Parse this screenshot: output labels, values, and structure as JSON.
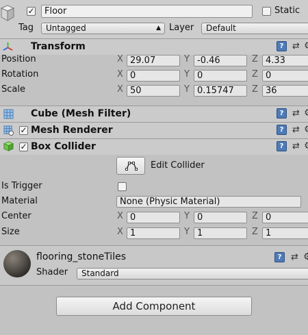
{
  "gameobject": {
    "active": true,
    "name": "Floor",
    "static_checked": false,
    "static_label": "Static",
    "tag_label": "Tag",
    "tag_value": "Untagged",
    "layer_label": "Layer",
    "layer_value": "Default"
  },
  "transform": {
    "title": "Transform",
    "rows": [
      {
        "label": "Position",
        "x": "29.07",
        "y": "-0.46",
        "z": "4.33"
      },
      {
        "label": "Rotation",
        "x": "0",
        "y": "0",
        "z": "0"
      },
      {
        "label": "Scale",
        "x": "50",
        "y": "0.15747",
        "z": "36"
      }
    ]
  },
  "axes": {
    "x": "X",
    "y": "Y",
    "z": "Z"
  },
  "mesh_filter": {
    "title": "Cube (Mesh Filter)"
  },
  "mesh_renderer": {
    "title": "Mesh Renderer",
    "enabled": true
  },
  "box_collider": {
    "title": "Box Collider",
    "enabled": true,
    "edit_label": "Edit Collider",
    "is_trigger_label": "Is Trigger",
    "is_trigger": false,
    "material_label": "Material",
    "material_value": "None (Physic Material)",
    "center_label": "Center",
    "center": {
      "x": "0",
      "y": "0",
      "z": "0"
    },
    "size_label": "Size",
    "size": {
      "x": "1",
      "y": "1",
      "z": "1"
    }
  },
  "material": {
    "name": "flooring_stoneTiles",
    "shader_label": "Shader",
    "shader_value": "Standard"
  },
  "add_component_label": "Add Component",
  "help_glyph": "?",
  "check_glyph": "✓",
  "colors": {
    "panel_bg": "#c2c2c2",
    "header_bg": "#cbcbcb",
    "help_blue": "#4e7bb8"
  }
}
